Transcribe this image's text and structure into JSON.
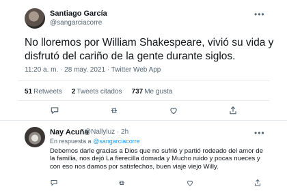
{
  "tweet": {
    "author_name": "Santiago García",
    "author_handle": "@sangarciacorre",
    "text": "No lloremos por William Shakespeare, vivió su vida y disfrutó del cariño de la gente durante siglos.",
    "meta": "11:20 a. m. · 28 may. 2021 · Twitter Web App",
    "stats": {
      "retweets_count": "51",
      "retweets_label": "Retweets",
      "quotes_count": "2",
      "quotes_label": "Tweets citados",
      "likes_count": "737",
      "likes_label": "Me gusta"
    },
    "actions": [
      "reply-icon",
      "retweet-icon",
      "like-icon",
      "share-icon"
    ]
  },
  "reply": {
    "author_name": "Nay Acuña",
    "author_handle": "@Nallyluz · 2h",
    "context_prefix": "En respuesta a",
    "context_handle": "@sangarciacorre",
    "text": "Debemos darle gracias a Dios que no sufrió y partió rodeado del amor de la familia, nos dejó La fierecilla domada y Mucho ruido y pocas nueces y con eso nos damos por satisfechos, buen viaje viejo Willy.",
    "actions": [
      "reply-icon",
      "retweet-icon",
      "like-icon",
      "share-icon"
    ]
  },
  "colors": {
    "link": "#1d9bf0",
    "secondary_text": "#536471",
    "primary_text": "#0f1419"
  }
}
